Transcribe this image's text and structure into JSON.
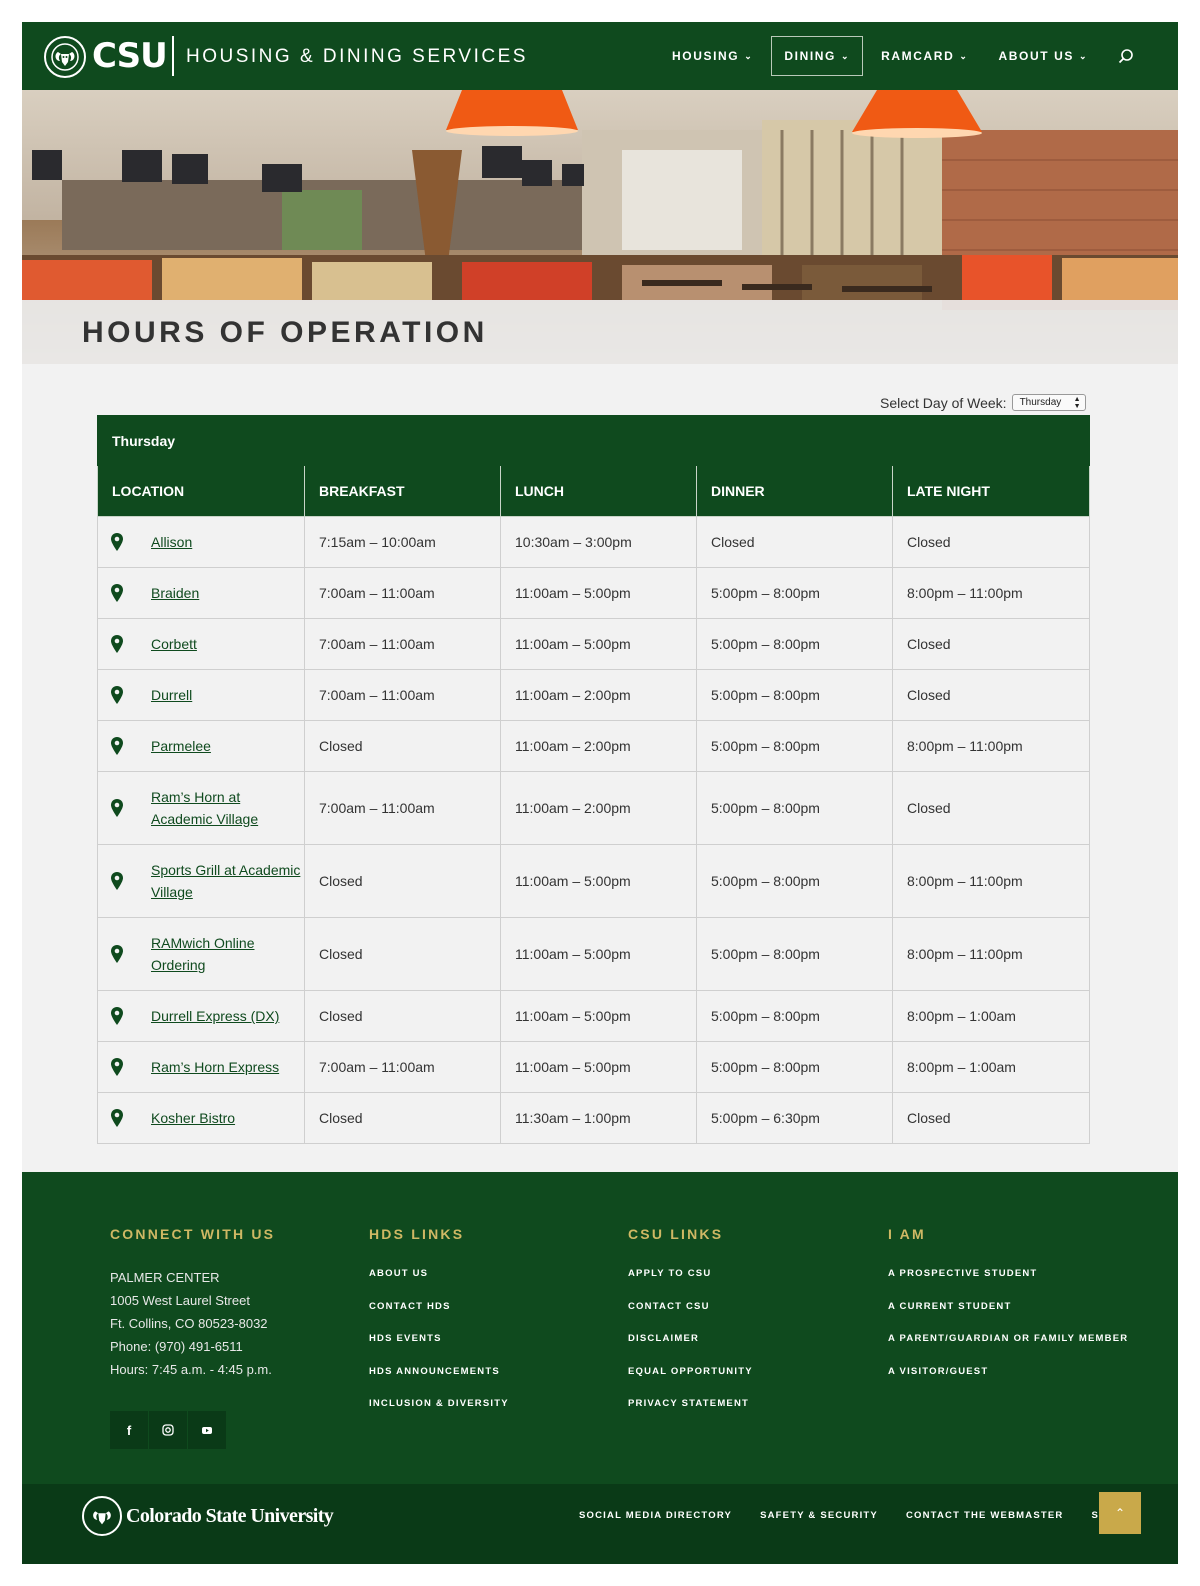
{
  "header": {
    "logo_text": "CSU",
    "site_name": "HOUSING & DINING SERVICES",
    "nav": [
      {
        "label": "HOUSING"
      },
      {
        "label": "DINING"
      },
      {
        "label": "RAMCARD"
      },
      {
        "label": "ABOUT US"
      }
    ],
    "icons": {
      "search": "search-icon",
      "chevron": "chevron-down-icon",
      "logo": "ram-logo-icon"
    }
  },
  "hero": {
    "title": "HOURS OF OPERATION"
  },
  "filter": {
    "label": "Select Day of Week:",
    "selected": "Thursday"
  },
  "table": {
    "day": "Thursday",
    "columns": [
      "LOCATION",
      "BREAKFAST",
      "LUNCH",
      "DINNER",
      "LATE NIGHT"
    ],
    "rows": [
      {
        "location": "Allison",
        "breakfast": "7:15am – 10:00am",
        "lunch": "10:30am – 3:00pm",
        "dinner": "Closed",
        "late_night": "Closed"
      },
      {
        "location": "Braiden",
        "breakfast": "7:00am – 11:00am",
        "lunch": "11:00am – 5:00pm",
        "dinner": "5:00pm – 8:00pm",
        "late_night": "8:00pm – 11:00pm"
      },
      {
        "location": "Corbett",
        "breakfast": "7:00am – 11:00am",
        "lunch": "11:00am – 5:00pm",
        "dinner": "5:00pm – 8:00pm",
        "late_night": "Closed"
      },
      {
        "location": "Durrell",
        "breakfast": "7:00am – 11:00am",
        "lunch": "11:00am – 2:00pm",
        "dinner": "5:00pm – 8:00pm",
        "late_night": "Closed"
      },
      {
        "location": "Parmelee",
        "breakfast": "Closed",
        "lunch": "11:00am – 2:00pm",
        "dinner": "5:00pm – 8:00pm",
        "late_night": "8:00pm – 11:00pm"
      },
      {
        "location": "Ram’s Horn at Academic Village",
        "breakfast": "7:00am – 11:00am",
        "lunch": "11:00am – 2:00pm",
        "dinner": "5:00pm – 8:00pm",
        "late_night": "Closed"
      },
      {
        "location": "Sports Grill at Academic Village",
        "breakfast": "Closed",
        "lunch": "11:00am – 5:00pm",
        "dinner": "5:00pm – 8:00pm",
        "late_night": "8:00pm – 11:00pm"
      },
      {
        "location": "RAMwich Online Ordering",
        "breakfast": "Closed",
        "lunch": "11:00am – 5:00pm",
        "dinner": "5:00pm – 8:00pm",
        "late_night": "8:00pm – 11:00pm"
      },
      {
        "location": "Durrell Express (DX)",
        "breakfast": "Closed",
        "lunch": "11:00am – 5:00pm",
        "dinner": "5:00pm – 8:00pm",
        "late_night": "8:00pm – 1:00am"
      },
      {
        "location": "Ram’s Horn Express",
        "breakfast": "7:00am – 11:00am",
        "lunch": "11:00am – 5:00pm",
        "dinner": "5:00pm – 8:00pm",
        "late_night": "8:00pm – 1:00am"
      },
      {
        "location": "Kosher Bistro",
        "breakfast": "Closed",
        "lunch": "11:30am – 1:00pm",
        "dinner": "5:00pm – 6:30pm",
        "late_night": "Closed"
      }
    ]
  },
  "footer": {
    "connect": {
      "heading": "CONNECT WITH US",
      "address": [
        "PALMER CENTER",
        "1005 West Laurel Street",
        "Ft. Collins, CO 80523-8032",
        "Phone: (970) 491-6511",
        "Hours: 7:45 a.m. - 4:45 p.m."
      ],
      "social": [
        {
          "icon": "facebook-icon",
          "glyph": "f"
        },
        {
          "icon": "instagram-icon",
          "glyph": ""
        },
        {
          "icon": "youtube-icon",
          "glyph": ""
        }
      ]
    },
    "hds_links": {
      "heading": "HDS LINKS",
      "links": [
        "ABOUT US",
        "CONTACT HDS",
        "HDS EVENTS",
        "HDS ANNOUNCEMENTS",
        "INCLUSION & DIVERSITY"
      ]
    },
    "csu_links": {
      "heading": "CSU LINKS",
      "links": [
        "APPLY TO CSU",
        "CONTACT CSU",
        "DISCLAIMER",
        "EQUAL OPPORTUNITY",
        "PRIVACY STATEMENT"
      ]
    },
    "i_am": {
      "heading": "I AM",
      "links": [
        "A PROSPECTIVE STUDENT",
        "A CURRENT STUDENT",
        "A PARENT/GUARDIAN OR FAMILY MEMBER",
        "A VISITOR/GUEST"
      ]
    }
  },
  "bottom_bar": {
    "university": "Colorado State University",
    "links": [
      "SOCIAL MEDIA DIRECTORY",
      "SAFETY & SECURITY",
      "CONTACT THE WEBMASTER",
      "SITE MAP"
    ],
    "back_to_top_icon": "chevron-up-icon"
  },
  "colors": {
    "brand_green": "#0f4a1e",
    "dark_green": "#0a3a17",
    "gold": "#cfb864",
    "back_to_top": "#c9a94a",
    "background": "#f2f2f2"
  }
}
